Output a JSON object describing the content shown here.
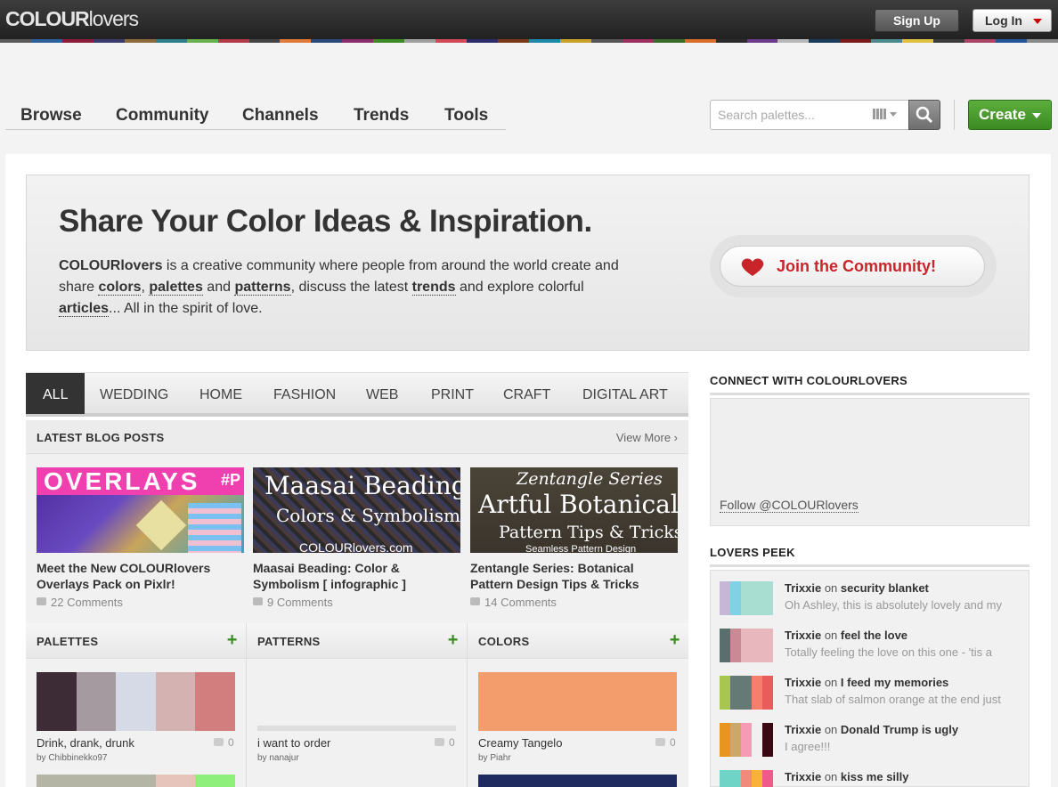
{
  "header": {
    "logo_bold": "COLOUR",
    "logo_light": "lovers",
    "signup": "Sign Up",
    "login": "Log In"
  },
  "stripe_colors": [
    "#5a5a5a",
    "#2d5f9b",
    "#8a1c3a",
    "#3a3a6e",
    "#8c6a3a",
    "#2e7d8a",
    "#6ab04c",
    "#b23a48",
    "#444444",
    "#e07a3a",
    "#2a4a7a",
    "#8a2b6b",
    "#3b8a23",
    "#a0a0a0",
    "#d4495a",
    "#2b2b6b",
    "#7a3a1a",
    "#1e88a8",
    "#c9a227",
    "#555555",
    "#9a3060",
    "#3a6a2a",
    "#d86c2a",
    "#2a2a2a",
    "#6a3a8a",
    "#b8b8b8",
    "#1a3a5a",
    "#7a1a1a",
    "#4a8a8a",
    "#e0c040",
    "#3a3a3a",
    "#aa4466",
    "#225599",
    "#888888"
  ],
  "nav": {
    "items": [
      "Browse",
      "Community",
      "Channels",
      "Trends",
      "Tools"
    ]
  },
  "search": {
    "placeholder": "Search palettes..."
  },
  "create_label": "Create",
  "hero": {
    "title": "Share Your Color Ideas & Inspiration.",
    "intro_brand": "COLOURlovers",
    "t1": " is a creative community where people from around the world create and share ",
    "l_colors": "colors",
    "c1": ", ",
    "l_palettes": "palettes",
    "t2": " and ",
    "l_patterns": "patterns",
    "t3": ", discuss the latest ",
    "l_trends": "trends",
    "t4": " and explore colorful ",
    "l_articles": "articles",
    "t5": "... All in the spirit of love.",
    "join": "Join the Community!"
  },
  "tabs": [
    "ALL",
    "WEDDING",
    "HOME",
    "FASHION",
    "WEB",
    "PRINT",
    "CRAFT",
    "DIGITAL ART"
  ],
  "blog": {
    "header": "LATEST BLOG POSTS",
    "view_more": "View More ›",
    "posts": [
      {
        "thumb_text": "OVERLAYS",
        "thumb_sub": "#P",
        "title": "Meet the New COLOURlovers Overlays Pack on Pixlr!",
        "comments": "22 Comments"
      },
      {
        "thumb_text": "Maasai Beading",
        "thumb_sub": "Colors & Symbolism",
        "thumb_foot": "COLOURlovers.com",
        "title": "Maasai Beading: Color & Symbolism [ infographic ]",
        "comments": "9 Comments"
      },
      {
        "thumb_text": "Artful Botanical",
        "thumb_top": "Zentangle Series",
        "thumb_sub": "Pattern Tips & Tricks",
        "thumb_foot": "Seamless Pattern Design",
        "title": "Zentangle Series: Botanical Pattern Design Tips & Tricks",
        "comments": "14 Comments"
      }
    ]
  },
  "columns": {
    "palettes": {
      "header": "PALETTES",
      "name": "Drink, drank, drunk",
      "by": "by Chibbinekko97",
      "count": "0",
      "swatches": [
        "#3d2c36",
        "#a69aa1",
        "#d6dae6",
        "#d4b2b1",
        "#d27e7e"
      ],
      "next": [
        "#b5b5a6",
        "#e6c4bc",
        "#8ef07a"
      ]
    },
    "patterns": {
      "header": "PATTERNS",
      "name": "i want to order",
      "by": "by nanajur",
      "count": "0"
    },
    "colors": {
      "header": "COLORS",
      "name": "Creamy Tangelo",
      "by": "by Piahr",
      "count": "0",
      "swatch": "#f29d6b",
      "next": "#1f2a5e"
    }
  },
  "connect": {
    "header": "CONNECT WITH COLOURLOVERS",
    "follow": "Follow @COLOURlovers"
  },
  "peek": {
    "header": "LOVERS PEEK",
    "on": "on",
    "items": [
      {
        "user": "Trixxie",
        "title": "security blanket",
        "text": "Oh Ashley, this is absolutely lovely and my",
        "colors": [
          "#c7b6d6",
          "#7fd1e3",
          "#a8ddd2",
          "#a8ddd2",
          "#a8ddd2"
        ]
      },
      {
        "user": "Trixxie",
        "title": "feel the love",
        "text": "Totally feeling the love on this one - 'tis a",
        "colors": [
          "#5b6e6e",
          "#c98a96",
          "#e8b7bd",
          "#e8b7bd",
          "#e8b7bd"
        ]
      },
      {
        "user": "Trixxie",
        "title": "I feed my memories",
        "text": "That slab of salmon orange at the end just",
        "colors": [
          "#a7c64f",
          "#657a75",
          "#657a75",
          "#f57f6a",
          "#e85c5c"
        ]
      },
      {
        "user": "Trixxie",
        "title": "Donald Trump is ugly",
        "text": "I agree!!!",
        "colors": [
          "#e8951f",
          "#c9a869",
          "#f79ab5",
          "#f0f0f0",
          "#3a0812"
        ]
      },
      {
        "user": "Trixxie",
        "title": "kiss me silly",
        "text": "",
        "colors": [
          "#6fd3c6",
          "#6fd3c6",
          "#f08a7a",
          "#f8b23a",
          "#f05a8a"
        ]
      }
    ]
  }
}
